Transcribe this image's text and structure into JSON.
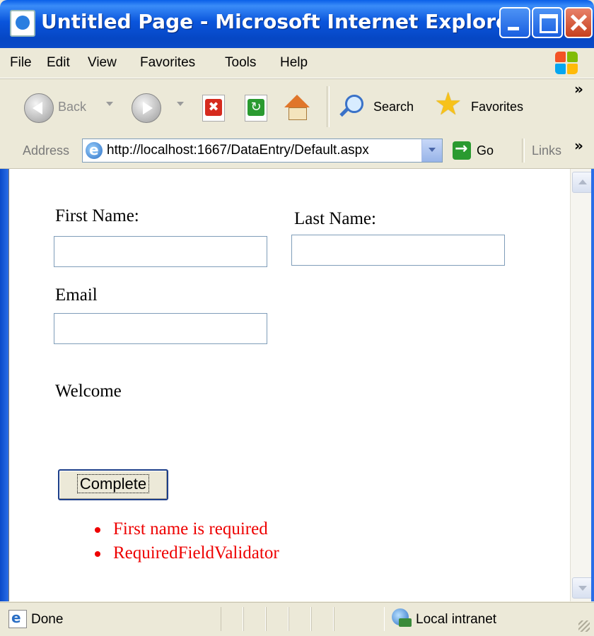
{
  "window": {
    "title": "Untitled Page - Microsoft Internet Explorer",
    "controls": [
      "minimize",
      "maximize",
      "close"
    ]
  },
  "menubar": {
    "items": [
      {
        "label": "File"
      },
      {
        "label": "Edit"
      },
      {
        "label": "View"
      },
      {
        "label": "Favorites"
      },
      {
        "label": "Tools"
      },
      {
        "label": "Help"
      }
    ]
  },
  "toolbar": {
    "back_label": "Back",
    "search_label": "Search",
    "favorites_label": "Favorites",
    "overflow": "»"
  },
  "addressbar": {
    "label": "Address",
    "url": "http://localhost:1667/DataEntry/Default.aspx",
    "go_label": "Go",
    "links_label": "Links",
    "overflow": "»"
  },
  "form": {
    "first_name_label": "First Name:",
    "first_name_value": "",
    "last_name_label": "Last Name:",
    "last_name_value": "",
    "email_label": "Email",
    "email_value": "",
    "welcome_text": "Welcome",
    "complete_button": "Complete",
    "errors": [
      "First name is required",
      "RequiredFieldValidator"
    ],
    "error_color": "#e00000"
  },
  "statusbar": {
    "status_text": "Done",
    "zone_text": "Local intranet"
  },
  "colors": {
    "titlebar": "#0a55dc",
    "chrome": "#ece9d8",
    "field_border": "#7f9db9"
  }
}
